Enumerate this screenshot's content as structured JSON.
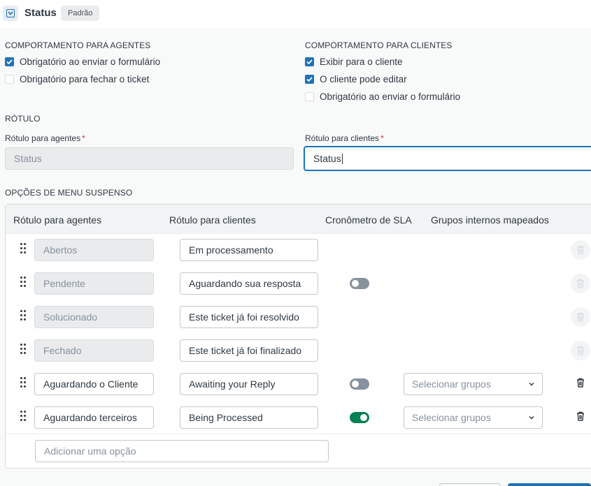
{
  "header": {
    "icon": "dropdown-field-icon",
    "title": "Status",
    "badge": "Padrão"
  },
  "agents_behavior": {
    "title": "COMPORTAMENTO PARA AGENTES",
    "options": [
      {
        "label": "Obrigatório ao enviar o formulário",
        "checked": true
      },
      {
        "label": "Obrigatório para fechar o ticket",
        "checked": false
      }
    ]
  },
  "clients_behavior": {
    "title": "COMPORTAMENTO PARA CLIENTES",
    "options": [
      {
        "label": "Exibir para o cliente",
        "checked": true
      },
      {
        "label": "O cliente pode editar",
        "checked": true
      },
      {
        "label": "Obrigatório ao enviar o formulário",
        "checked": false
      }
    ]
  },
  "label_section": {
    "title": "RÓTULO",
    "agent_label": {
      "label": "Rótulo para agentes",
      "required": "*",
      "value": "Status",
      "disabled": true
    },
    "client_label": {
      "label": "Rótulo para clientes",
      "required": "*",
      "value": "Status",
      "focused": true
    }
  },
  "dropdown": {
    "title": "OPÇÕES DE MENU SUSPENSO",
    "columns": [
      "Rótulo para agentes",
      "Rótulo para clientes",
      "Cronômetro de SLA",
      "Grupos internos mapeados"
    ],
    "rows": [
      {
        "agent": "Abertos",
        "client": "Em processamento",
        "agent_disabled": true,
        "sla": null,
        "groups": null,
        "deletable": false
      },
      {
        "agent": "Pendente",
        "client": "Aguardando sua resposta",
        "agent_disabled": true,
        "sla": "off",
        "groups": null,
        "deletable": false
      },
      {
        "agent": "Solucionado",
        "client": "Este ticket já foi resolvido",
        "agent_disabled": true,
        "sla": null,
        "groups": null,
        "deletable": false
      },
      {
        "agent": "Fechado",
        "client": "Este ticket já foi finalizado",
        "agent_disabled": true,
        "sla": null,
        "groups": null,
        "deletable": false
      },
      {
        "agent": "Aguardando o Cliente",
        "client": "Awaiting your Reply",
        "agent_disabled": false,
        "sla": "off",
        "groups": "Selecionar grupos",
        "deletable": true
      },
      {
        "agent": "Aguardando terceiros",
        "client": "Being Processed",
        "agent_disabled": false,
        "sla": "on",
        "groups": "Selecionar grupos",
        "deletable": true
      }
    ],
    "add_placeholder": "Adicionar uma opção"
  },
  "colors": {
    "accent": "#1f73b7",
    "toggle_on": "#038153",
    "toggle_off": "#87929d",
    "required": "#cc3340"
  }
}
